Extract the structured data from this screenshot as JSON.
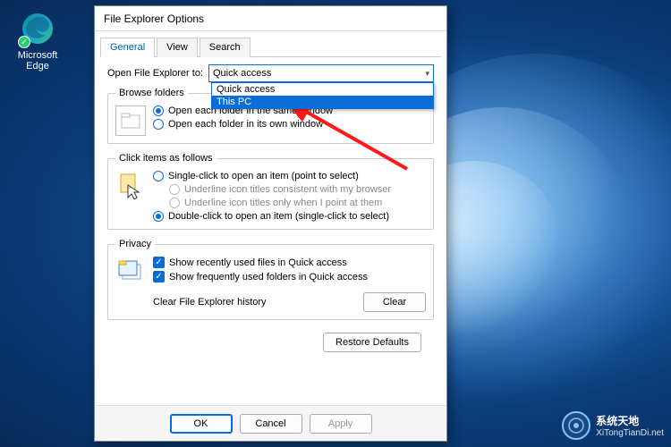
{
  "desktop": {
    "icon_label": "Microsoft Edge"
  },
  "dialog": {
    "title": "File Explorer Options",
    "tabs": [
      "General",
      "View",
      "Search"
    ],
    "open_label": "Open File Explorer to:",
    "combo_selected": "Quick access",
    "combo_options": [
      "Quick access",
      "This PC"
    ],
    "browse": {
      "legend": "Browse folders",
      "same": "Open each folder in the same window",
      "own": "Open each folder in its own window"
    },
    "click": {
      "legend": "Click items as follows",
      "single": "Single-click to open an item (point to select)",
      "u1": "Underline icon titles consistent with my browser",
      "u2": "Underline icon titles only when I point at them",
      "double": "Double-click to open an item (single-click to select)"
    },
    "privacy": {
      "legend": "Privacy",
      "recent": "Show recently used files in Quick access",
      "frequent": "Show frequently used folders in Quick access",
      "clear_label": "Clear File Explorer history",
      "clear_btn": "Clear"
    },
    "restore": "Restore Defaults",
    "ok": "OK",
    "cancel": "Cancel",
    "apply": "Apply"
  },
  "watermark": {
    "text": "系统天地",
    "url": "XiTongTianDi.net"
  }
}
